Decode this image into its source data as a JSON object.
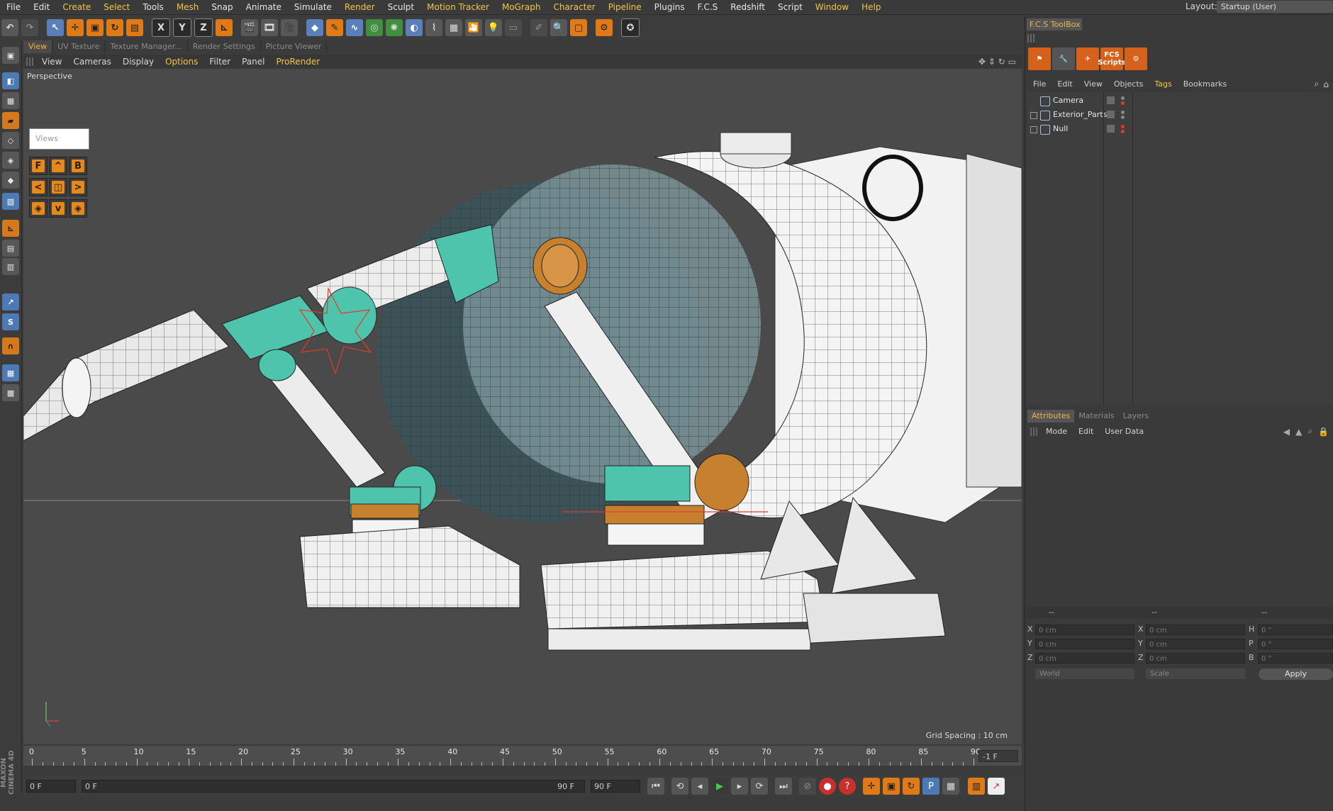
{
  "menubar": {
    "items": [
      "File",
      "Edit",
      "Create",
      "Select",
      "Tools",
      "Mesh",
      "Snap",
      "Animate",
      "Simulate",
      "Render",
      "Sculpt",
      "Motion Tracker",
      "MoGraph",
      "Character",
      "Pipeline",
      "Plugins",
      "F.C.S",
      "Redshift",
      "Script",
      "Window",
      "Help"
    ],
    "layout_label": "Layout:",
    "layout_value": "Startup (User)"
  },
  "toolbar": {
    "axis_x": "X",
    "axis_y": "Y",
    "axis_z": "Z"
  },
  "viewport": {
    "tabs": [
      "View",
      "UV Texture",
      "Texture Manager...",
      "Render Settings",
      "Picture Viewer"
    ],
    "menu": [
      "View",
      "Cameras",
      "Display",
      "Options",
      "Filter",
      "Panel",
      "ProRender"
    ],
    "camera_label": "Perspective",
    "grid_spacing": "Grid Spacing : 10 cm",
    "views_panel_label": "Views",
    "views_buttons": [
      "F",
      "^",
      "B",
      "<",
      "",
      "",
      "",
      "v",
      ""
    ]
  },
  "timeline": {
    "labels": [
      "0",
      "5",
      "10",
      "15",
      "20",
      "25",
      "30",
      "35",
      "40",
      "45",
      "50",
      "55",
      "60",
      "65",
      "70",
      "75",
      "80",
      "85",
      "90"
    ],
    "frame_end": "-1 F"
  },
  "playback": {
    "current_frame": "0 F",
    "range_start": "0 F",
    "range_end": "90 F",
    "max_frame": "90 F"
  },
  "brand": "MAXON CINEMA 4D",
  "right_panel": {
    "toolbox_title": "F.C.S ToolBox",
    "toolbox_icons": [
      "fcs-object-icon",
      "wrench-icon",
      "plane-icon",
      "FCS Scripts",
      "gear-icon"
    ],
    "fcs_scripts_label": "FCS Scripts",
    "object_menu": [
      "File",
      "Edit",
      "View",
      "Objects",
      "Tags",
      "Bookmarks"
    ],
    "objects": [
      {
        "name": "Camera",
        "icon": "camera-icon"
      },
      {
        "name": "Exterior_Parts",
        "icon": "null-icon"
      },
      {
        "name": "Null",
        "icon": "null-icon"
      }
    ],
    "attr_tabs": [
      "Attributes",
      "Materials",
      "Layers"
    ],
    "attr_menu": [
      "Mode",
      "Edit",
      "User Data"
    ],
    "coord_head": [
      "--",
      "--",
      "--"
    ],
    "coords": {
      "pos_labels": [
        "X",
        "Y",
        "Z"
      ],
      "pos_values": [
        "0 cm",
        "0 cm",
        "0 cm"
      ],
      "size_labels": [
        "X",
        "Y",
        "Z"
      ],
      "size_values": [
        "0 cm",
        "0 cm",
        "0 cm"
      ],
      "rot_labels": [
        "H",
        "P",
        "B"
      ],
      "rot_values": [
        "0 °",
        "0 °",
        "0 °"
      ]
    },
    "coord_system": "World",
    "coord_mode": "Scale",
    "apply_label": "Apply"
  },
  "colors": {
    "accent": "#f0b642",
    "orange_tool": "#e07a16",
    "blue_tool": "#4d7ab5",
    "model_teal": "#4fc4ad",
    "model_orange": "#c7802e"
  }
}
